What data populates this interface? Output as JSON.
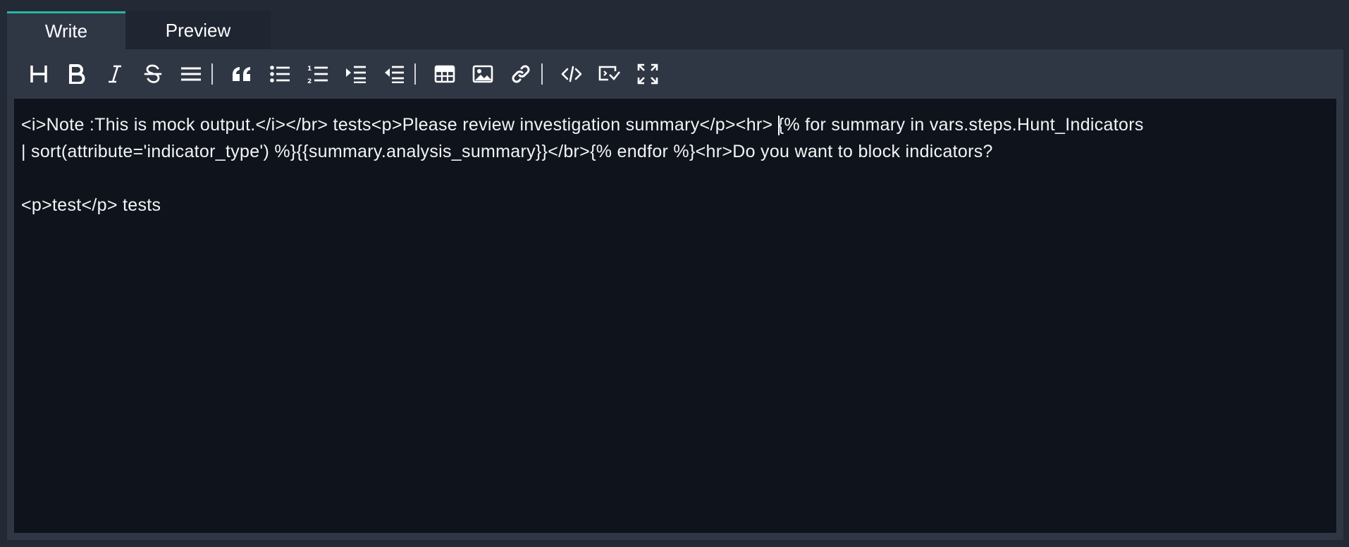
{
  "tabs": [
    {
      "label": "Write",
      "active": true
    },
    {
      "label": "Preview",
      "active": false
    }
  ],
  "toolbar": {
    "icons": [
      "heading-icon",
      "bold-icon",
      "italic-icon",
      "strikethrough-icon",
      "horizontal-rule-icon",
      "quote-icon",
      "unordered-list-icon",
      "ordered-list-icon",
      "indent-icon",
      "outdent-icon",
      "table-icon",
      "image-icon",
      "link-icon",
      "code-icon",
      "code-block-icon",
      "fullscreen-icon"
    ]
  },
  "editor": {
    "line1_before_caret": "<i>Note :This is mock output.</i></br> tests<p>Please review investigation summary</p><hr> ",
    "line1_after_caret": "{% for summary in vars.steps.Hunt_Indicators",
    "line2": "| sort(attribute='indicator_type') %}{{summary.analysis_summary}}</br>{% endfor %}<hr>Do you want to block indicators?",
    "line3": "",
    "line4": "<p>test</p> tests"
  },
  "colors": {
    "background": "#232a36",
    "frame": "#303744",
    "editor_bg": "#0f141c",
    "accent": "#2bb3a6"
  }
}
